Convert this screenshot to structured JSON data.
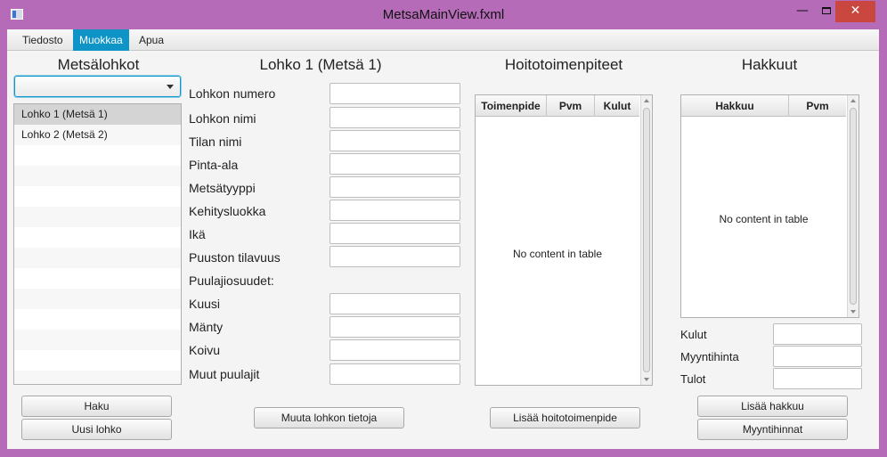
{
  "window": {
    "title": "MetsaMainView.fxml",
    "minimize_label": "—",
    "close_label": "✕"
  },
  "menu": {
    "items": [
      "Tiedosto",
      "Muokkaa",
      "Apua"
    ],
    "active": "Muokkaa"
  },
  "left_panel": {
    "title": "Metsälohkot",
    "combo_value": "",
    "list_items": [
      "Lohko 1 (Metsä 1)",
      "Lohko 2 (Metsä 2)"
    ],
    "selected_item": "Lohko 1 (Metsä 1)",
    "buttons": {
      "haku": "Haku",
      "uusi_lohko": "Uusi lohko"
    }
  },
  "form": {
    "title": "Lohko 1 (Metsä 1)",
    "fields": [
      {
        "label": "Lohkon numero",
        "value": ""
      },
      {
        "label": "Lohkon nimi",
        "value": ""
      },
      {
        "label": "Tilan nimi",
        "value": ""
      },
      {
        "label": "Pinta-ala",
        "value": ""
      },
      {
        "label": "Metsätyyppi",
        "value": ""
      },
      {
        "label": "Kehitysluokka",
        "value": ""
      },
      {
        "label": "Ikä",
        "value": ""
      },
      {
        "label": "Puuston tilavuus",
        "value": ""
      }
    ],
    "species_heading": "Puulajiosuudet:",
    "species_fields": [
      {
        "label": "Kuusi",
        "value": ""
      },
      {
        "label": "Mänty",
        "value": ""
      },
      {
        "label": "Koivu",
        "value": ""
      },
      {
        "label": "Muut puulajit",
        "value": ""
      }
    ],
    "save_button": "Muuta lohkon tietoja"
  },
  "hoito": {
    "title": "Hoitotoimenpiteet",
    "columns": [
      "Toimenpide",
      "Pvm",
      "Kulut"
    ],
    "empty_text": "No content in table",
    "add_button": "Lisää hoitotoimenpide"
  },
  "hakkuut": {
    "title": "Hakkuut",
    "columns": [
      "Hakkuu",
      "Pvm"
    ],
    "empty_text": "No content in table",
    "summary": [
      {
        "label": "Kulut",
        "value": ""
      },
      {
        "label": "Myyntihinta",
        "value": ""
      },
      {
        "label": "Tulot",
        "value": ""
      }
    ],
    "add_button": "Lisää hakkuu",
    "prices_button": "Myyntihinnat"
  },
  "colors": {
    "frame": "#b56bb8",
    "accent": "#0f94c8",
    "close": "#c9473e"
  }
}
